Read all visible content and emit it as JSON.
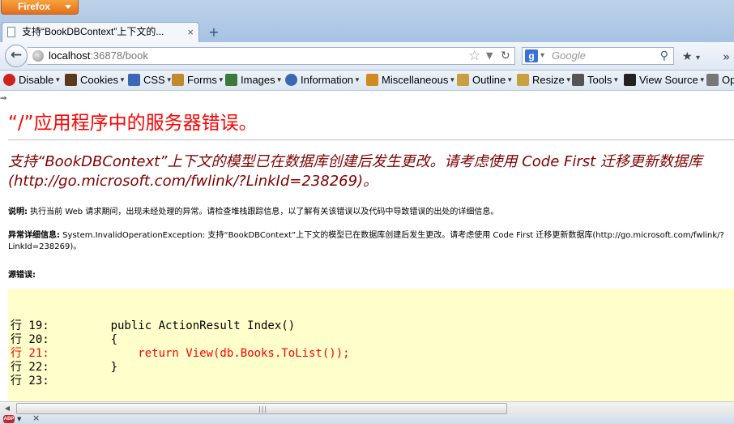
{
  "browser": {
    "menu_button": "Firefox",
    "tab": {
      "title": "支持“BookDBContext”上下文的...",
      "close": "×"
    },
    "new_tab": "+",
    "url": {
      "host": "localhost",
      "rest": ":36878/book"
    },
    "search": {
      "engine_glyph": "g",
      "placeholder": "Google"
    },
    "bookmarks_glyph": "★",
    "more_glyph": "»"
  },
  "web_dev_toolbar": {
    "items": [
      {
        "label": "Disable",
        "icon": "disable-icon",
        "color": "#cc2222"
      },
      {
        "label": "Cookies",
        "icon": "cookies-icon",
        "color": "#5a3a1a"
      },
      {
        "label": "CSS",
        "icon": "css-icon",
        "color": "#3a68b4"
      },
      {
        "label": "Forms",
        "icon": "forms-icon",
        "color": "#c08a30"
      },
      {
        "label": "Images",
        "icon": "images-icon",
        "color": "#3a7a3a"
      },
      {
        "label": "Information",
        "icon": "information-icon",
        "color": "#3a68b4"
      },
      {
        "label": "Miscellaneous",
        "icon": "miscellaneous-icon",
        "color": "#d08a20"
      },
      {
        "label": "Outline",
        "icon": "outline-icon",
        "color": "#c8a040"
      },
      {
        "label": "Resize",
        "icon": "resize-icon",
        "color": "#c8a040"
      },
      {
        "label": "Tools",
        "icon": "tools-icon",
        "color": "#555555"
      },
      {
        "label": "View Source",
        "icon": "view-source-icon",
        "color": "#222222"
      },
      {
        "label": "Op",
        "icon": "options-icon",
        "color": "#777777"
      }
    ]
  },
  "error_page": {
    "heading": "“/”应用程序中的服务器错误。",
    "title": "支持“BookDBContext”上下文的模型已在数据库创建后发生更改。请考虑使用 Code First 迁移更新数据库(http://go.microsoft.com/fwlink/?LinkId=238269)。",
    "description_label": "说明:",
    "description": " 执行当前 Web 请求期间，出现未经处理的异常。请检查堆栈跟踪信息，以了解有关该错误以及代码中导致错误的出处的详细信息。",
    "exception_label": "异常详细信息:",
    "exception": " System.InvalidOperationException: 支持“BookDBContext”上下文的模型已在数据库创建后发生更改。请考虑使用 Code First 迁移更新数据库(http://go.microsoft.com/fwlink/?LinkId=238269)。",
    "source_label": "源错误:",
    "code_lines": [
      "行 19:         public ActionResult Index()",
      "行 20:         {",
      "行 21:             return View(db.Books.ToList());",
      "行 22:         }",
      "行 23:"
    ]
  },
  "colors": {
    "error_heading": "#ff0000",
    "error_title": "#800000",
    "code_background": "#ffffcc",
    "error_line": "#ff0000"
  }
}
